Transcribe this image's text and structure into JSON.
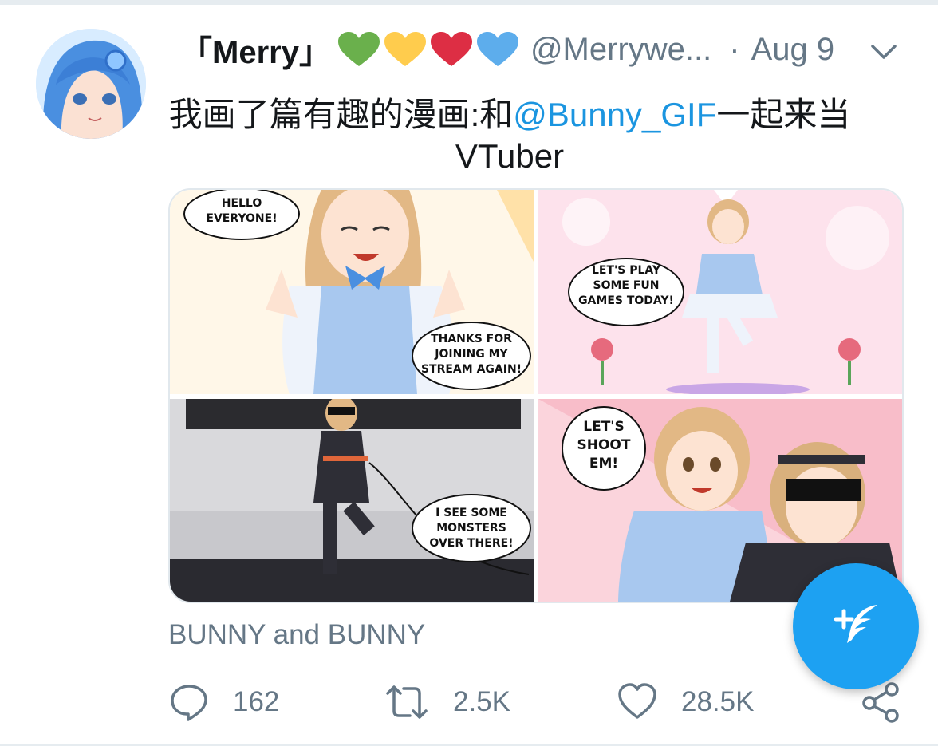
{
  "colors": {
    "accent": "#1da1f2",
    "mention": "#1b95e0",
    "muted": "#657786",
    "text": "#14171a"
  },
  "tweet": {
    "display_name": "「Merry」",
    "handle": "@Merrywe...",
    "separator": "·",
    "date": "Aug 9",
    "hearts": [
      {
        "icon": "green-heart-icon",
        "color": "#6ab04c"
      },
      {
        "icon": "yellow-heart-icon",
        "color": "#ffcc4d"
      },
      {
        "icon": "red-heart-icon",
        "color": "#dd2e44"
      },
      {
        "icon": "blue-heart-icon",
        "color": "#5dadec"
      }
    ],
    "text_before": "我画了篇有趣的漫画:和",
    "mention": "@Bunny_GIF",
    "text_after": "一起来当VTuber",
    "media_caption": "BUNNY and BUNNY"
  },
  "comic": {
    "panel1": {
      "bubble1": "HELLO\nEVERYONE!",
      "bubble2": "THANKS FOR\nJOINING MY\nSTREAM AGAIN!"
    },
    "panel2": {
      "bubble1": "LET'S PLAY\nSOME FUN\nGAMES TODAY!"
    },
    "panel3": {
      "bubble1": "I SEE SOME\nMONSTERS\nOVER THERE!"
    },
    "panel4": {
      "bubble1": "LET'S\nSHOOT\nEM!"
    }
  },
  "actions": {
    "reply_count": "162",
    "retweet_count": "2.5K",
    "like_count": "28.5K"
  },
  "icons": {
    "caret": "chevron-down-icon",
    "reply": "reply-icon",
    "retweet": "retweet-icon",
    "like": "heart-outline-icon",
    "share": "share-icon",
    "compose": "compose-tweet-icon"
  }
}
